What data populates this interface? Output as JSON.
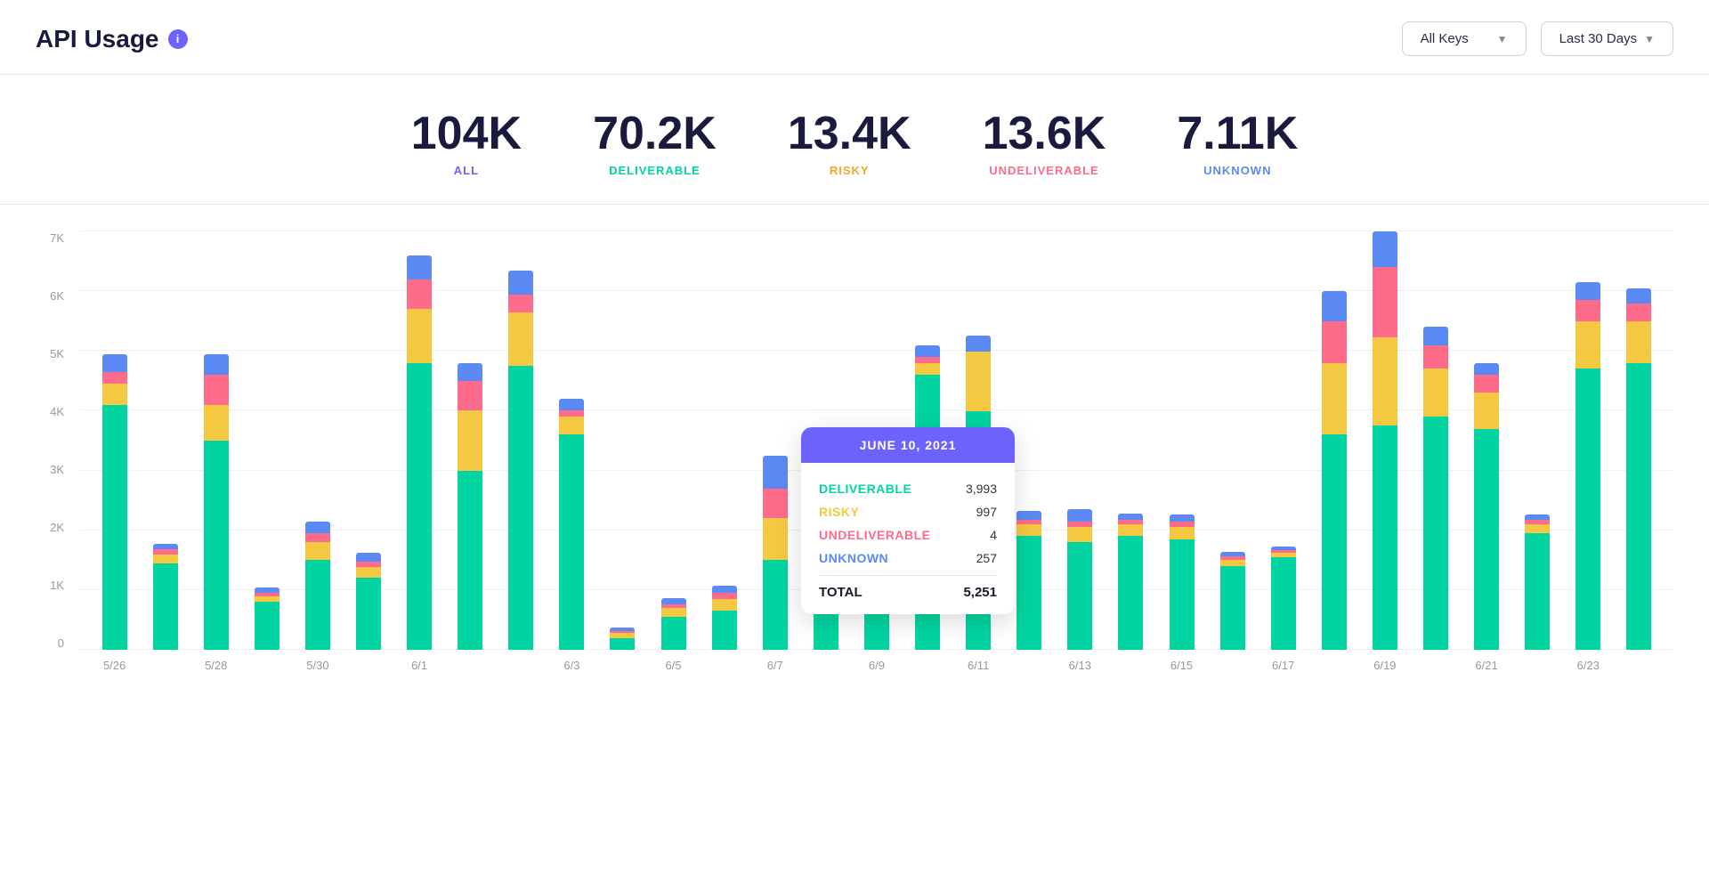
{
  "header": {
    "title": "API Usage",
    "info_icon": "i",
    "controls": {
      "keys_label": "All Keys",
      "period_label": "Last 30 Days"
    }
  },
  "stats": [
    {
      "id": "all",
      "value": "104K",
      "label": "ALL",
      "color_class": "label-all"
    },
    {
      "id": "deliverable",
      "value": "70.2K",
      "label": "DELIVERABLE",
      "color_class": "label-deliverable"
    },
    {
      "id": "risky",
      "value": "13.4K",
      "label": "RISKY",
      "color_class": "label-risky"
    },
    {
      "id": "undeliverable",
      "value": "13.6K",
      "label": "UNDELIVERABLE",
      "color_class": "label-undeliverable"
    },
    {
      "id": "unknown",
      "value": "7.11K",
      "label": "UNKNOWN",
      "color_class": "label-unknown"
    }
  ],
  "chart": {
    "y_labels": [
      "7K",
      "6K",
      "5K",
      "4K",
      "3K",
      "2K",
      "1K",
      "0"
    ],
    "max_value": 7000,
    "tooltip": {
      "date": "JUNE 10, 2021",
      "rows": [
        {
          "label": "DELIVERABLE",
          "value": "3,993",
          "color": "#00d4a0"
        },
        {
          "label": "RISKY",
          "value": "997",
          "color": "#f5c842"
        },
        {
          "label": "UNDELIVERABLE",
          "value": "4",
          "color": "#ff6b8a"
        },
        {
          "label": "UNKNOWN",
          "value": "257",
          "color": "#5b8af5"
        }
      ],
      "total_label": "TOTAL",
      "total_value": "5,251"
    },
    "bars": [
      {
        "date": "5/26",
        "deliverable": 4100,
        "risky": 350,
        "undeliverable": 200,
        "unknown": 300
      },
      {
        "date": "",
        "deliverable": 1450,
        "risky": 150,
        "undeliverable": 80,
        "unknown": 100
      },
      {
        "date": "5/28",
        "deliverable": 3500,
        "risky": 600,
        "undeliverable": 500,
        "unknown": 350
      },
      {
        "date": "",
        "deliverable": 800,
        "risky": 100,
        "undeliverable": 60,
        "unknown": 80
      },
      {
        "date": "5/30",
        "deliverable": 1500,
        "risky": 300,
        "undeliverable": 150,
        "unknown": 200
      },
      {
        "date": "",
        "deliverable": 1200,
        "risky": 180,
        "undeliverable": 100,
        "unknown": 150
      },
      {
        "date": "6/1",
        "deliverable": 4800,
        "risky": 900,
        "undeliverable": 500,
        "unknown": 400
      },
      {
        "date": "",
        "deliverable": 3000,
        "risky": 1000,
        "undeliverable": 500,
        "unknown": 300
      },
      {
        "date": "",
        "deliverable": 4750,
        "risky": 900,
        "undeliverable": 300,
        "unknown": 400
      },
      {
        "date": "6/3",
        "deliverable": 3600,
        "risky": 300,
        "undeliverable": 100,
        "unknown": 200
      },
      {
        "date": "",
        "deliverable": 200,
        "risky": 80,
        "undeliverable": 40,
        "unknown": 60
      },
      {
        "date": "6/5",
        "deliverable": 550,
        "risky": 150,
        "undeliverable": 60,
        "unknown": 100
      },
      {
        "date": "",
        "deliverable": 650,
        "risky": 200,
        "undeliverable": 100,
        "unknown": 120
      },
      {
        "date": "6/7",
        "deliverable": 1500,
        "risky": 700,
        "undeliverable": 500,
        "unknown": 550
      },
      {
        "date": "",
        "deliverable": 2200,
        "risky": 300,
        "undeliverable": 150,
        "unknown": 200
      },
      {
        "date": "6/9",
        "deliverable": 1000,
        "risky": 100,
        "undeliverable": 50,
        "unknown": 80
      },
      {
        "date": "",
        "deliverable": 4600,
        "risky": 200,
        "undeliverable": 100,
        "unknown": 200
      },
      {
        "date": "6/11",
        "deliverable": 3993,
        "risky": 997,
        "undeliverable": 4,
        "unknown": 257
      },
      {
        "date": "",
        "deliverable": 1900,
        "risky": 200,
        "undeliverable": 80,
        "unknown": 150
      },
      {
        "date": "6/13",
        "deliverable": 1800,
        "risky": 250,
        "undeliverable": 100,
        "unknown": 200
      },
      {
        "date": "",
        "deliverable": 1900,
        "risky": 200,
        "undeliverable": 80,
        "unknown": 100
      },
      {
        "date": "6/15",
        "deliverable": 1850,
        "risky": 200,
        "undeliverable": 90,
        "unknown": 120
      },
      {
        "date": "",
        "deliverable": 1400,
        "risky": 100,
        "undeliverable": 60,
        "unknown": 80
      },
      {
        "date": "6/17",
        "deliverable": 1550,
        "risky": 80,
        "undeliverable": 40,
        "unknown": 60
      },
      {
        "date": "",
        "deliverable": 3600,
        "risky": 1200,
        "undeliverable": 700,
        "unknown": 500
      },
      {
        "date": "6/19",
        "deliverable": 3800,
        "risky": 1500,
        "undeliverable": 1200,
        "unknown": 600
      },
      {
        "date": "",
        "deliverable": 3900,
        "risky": 800,
        "undeliverable": 400,
        "unknown": 300
      },
      {
        "date": "6/21",
        "deliverable": 3700,
        "risky": 600,
        "undeliverable": 300,
        "unknown": 200
      },
      {
        "date": "",
        "deliverable": 1950,
        "risky": 150,
        "undeliverable": 70,
        "unknown": 100
      },
      {
        "date": "6/23",
        "deliverable": 4700,
        "risky": 800,
        "undeliverable": 350,
        "unknown": 300
      },
      {
        "date": "",
        "deliverable": 4800,
        "risky": 700,
        "undeliverable": 300,
        "unknown": 250
      }
    ]
  }
}
